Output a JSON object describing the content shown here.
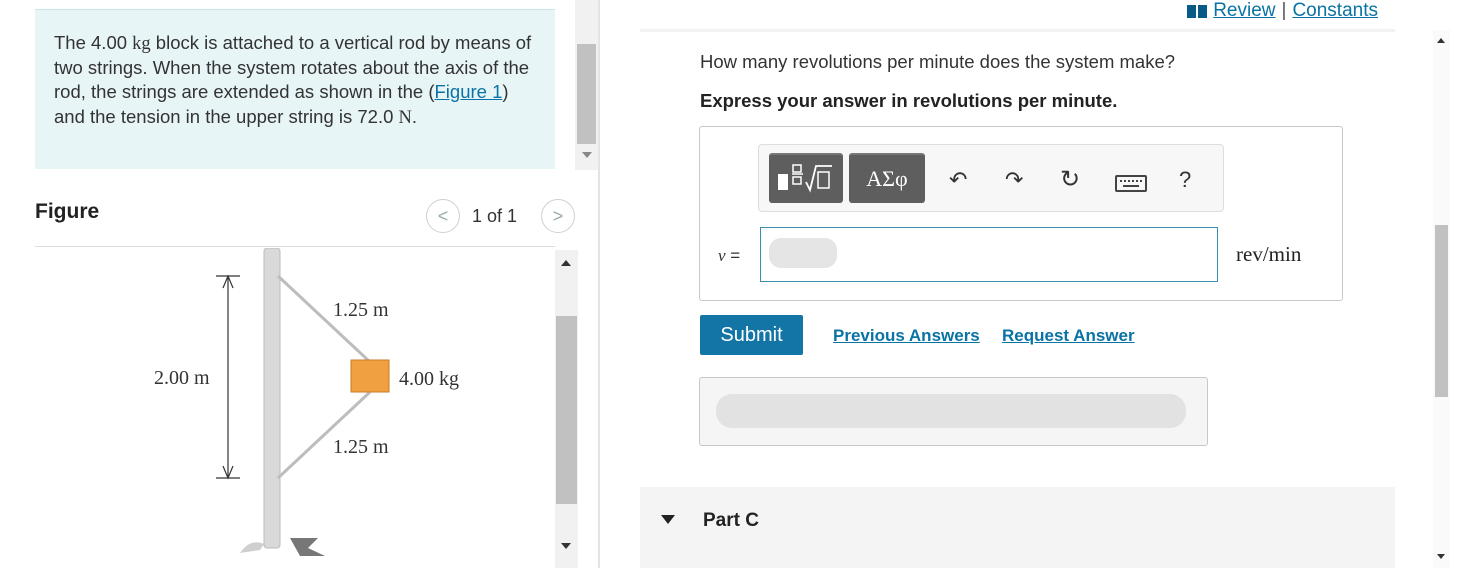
{
  "problem": {
    "text_before": "The 4.00 ",
    "kg": "kg",
    "text_middle": " block is attached to a vertical rod by means of two strings. When the system rotates about the axis of the rod, the strings are extended as shown in the (",
    "figure_link": "Figure 1",
    "text_after": ") and the tension in the upper string is 72.0 ",
    "newton": "N",
    "period": "."
  },
  "figure": {
    "title": "Figure",
    "pager": "1 of 1",
    "prev_symbol": "<",
    "next_symbol": ">",
    "labels": {
      "upper_string": "1.25 m",
      "lower_string": "1.25 m",
      "height": "2.00 m",
      "mass": "4.00 kg"
    },
    "colors": {
      "block": "#f0a040",
      "rod": "#d9d9d9",
      "string": "#bdbdbd"
    }
  },
  "header": {
    "review": "Review",
    "separator": "|",
    "constants": "Constants"
  },
  "question": {
    "prompt": "How many revolutions per minute does the system make?",
    "instruction": "Express your answer in revolutions per minute."
  },
  "toolbar": {
    "symbols_label": "ΑΣφ",
    "undo": "↶",
    "redo": "↷",
    "reset": "↻",
    "help": "?"
  },
  "answer": {
    "variable": "ν",
    "equals": " =",
    "value": "",
    "unit": "rev/min"
  },
  "actions": {
    "submit": "Submit",
    "previous_answers": "Previous Answers",
    "request_answer": "Request Answer"
  },
  "part_c": {
    "label": "Part C"
  },
  "colors": {
    "accent": "#1275a6",
    "link": "#0a73a5",
    "problem_bg": "#e8f5f7"
  }
}
